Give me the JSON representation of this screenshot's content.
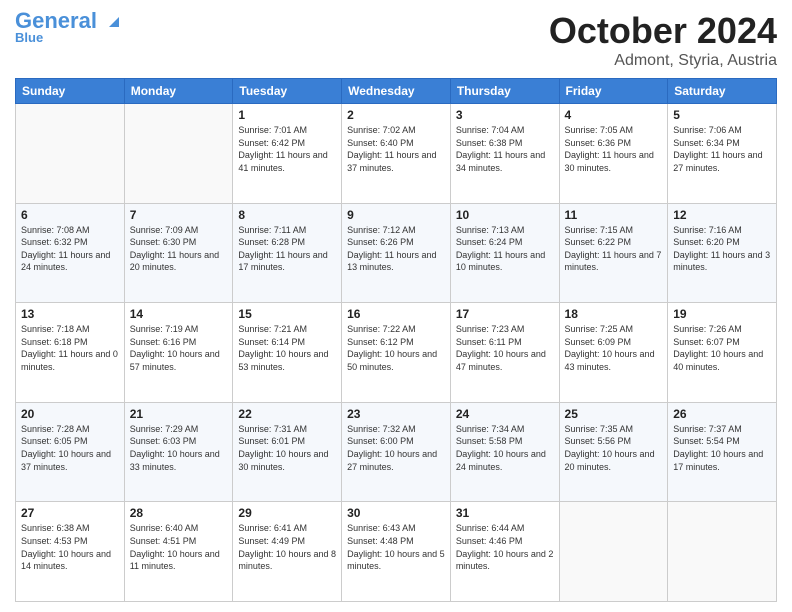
{
  "header": {
    "logo_main": "General",
    "logo_sub": "Blue",
    "month": "October 2024",
    "location": "Admont, Styria, Austria"
  },
  "weekdays": [
    "Sunday",
    "Monday",
    "Tuesday",
    "Wednesday",
    "Thursday",
    "Friday",
    "Saturday"
  ],
  "weeks": [
    [
      {
        "day": "",
        "info": ""
      },
      {
        "day": "",
        "info": ""
      },
      {
        "day": "1",
        "info": "Sunrise: 7:01 AM\nSunset: 6:42 PM\nDaylight: 11 hours and 41 minutes."
      },
      {
        "day": "2",
        "info": "Sunrise: 7:02 AM\nSunset: 6:40 PM\nDaylight: 11 hours and 37 minutes."
      },
      {
        "day": "3",
        "info": "Sunrise: 7:04 AM\nSunset: 6:38 PM\nDaylight: 11 hours and 34 minutes."
      },
      {
        "day": "4",
        "info": "Sunrise: 7:05 AM\nSunset: 6:36 PM\nDaylight: 11 hours and 30 minutes."
      },
      {
        "day": "5",
        "info": "Sunrise: 7:06 AM\nSunset: 6:34 PM\nDaylight: 11 hours and 27 minutes."
      }
    ],
    [
      {
        "day": "6",
        "info": "Sunrise: 7:08 AM\nSunset: 6:32 PM\nDaylight: 11 hours and 24 minutes."
      },
      {
        "day": "7",
        "info": "Sunrise: 7:09 AM\nSunset: 6:30 PM\nDaylight: 11 hours and 20 minutes."
      },
      {
        "day": "8",
        "info": "Sunrise: 7:11 AM\nSunset: 6:28 PM\nDaylight: 11 hours and 17 minutes."
      },
      {
        "day": "9",
        "info": "Sunrise: 7:12 AM\nSunset: 6:26 PM\nDaylight: 11 hours and 13 minutes."
      },
      {
        "day": "10",
        "info": "Sunrise: 7:13 AM\nSunset: 6:24 PM\nDaylight: 11 hours and 10 minutes."
      },
      {
        "day": "11",
        "info": "Sunrise: 7:15 AM\nSunset: 6:22 PM\nDaylight: 11 hours and 7 minutes."
      },
      {
        "day": "12",
        "info": "Sunrise: 7:16 AM\nSunset: 6:20 PM\nDaylight: 11 hours and 3 minutes."
      }
    ],
    [
      {
        "day": "13",
        "info": "Sunrise: 7:18 AM\nSunset: 6:18 PM\nDaylight: 11 hours and 0 minutes."
      },
      {
        "day": "14",
        "info": "Sunrise: 7:19 AM\nSunset: 6:16 PM\nDaylight: 10 hours and 57 minutes."
      },
      {
        "day": "15",
        "info": "Sunrise: 7:21 AM\nSunset: 6:14 PM\nDaylight: 10 hours and 53 minutes."
      },
      {
        "day": "16",
        "info": "Sunrise: 7:22 AM\nSunset: 6:12 PM\nDaylight: 10 hours and 50 minutes."
      },
      {
        "day": "17",
        "info": "Sunrise: 7:23 AM\nSunset: 6:11 PM\nDaylight: 10 hours and 47 minutes."
      },
      {
        "day": "18",
        "info": "Sunrise: 7:25 AM\nSunset: 6:09 PM\nDaylight: 10 hours and 43 minutes."
      },
      {
        "day": "19",
        "info": "Sunrise: 7:26 AM\nSunset: 6:07 PM\nDaylight: 10 hours and 40 minutes."
      }
    ],
    [
      {
        "day": "20",
        "info": "Sunrise: 7:28 AM\nSunset: 6:05 PM\nDaylight: 10 hours and 37 minutes."
      },
      {
        "day": "21",
        "info": "Sunrise: 7:29 AM\nSunset: 6:03 PM\nDaylight: 10 hours and 33 minutes."
      },
      {
        "day": "22",
        "info": "Sunrise: 7:31 AM\nSunset: 6:01 PM\nDaylight: 10 hours and 30 minutes."
      },
      {
        "day": "23",
        "info": "Sunrise: 7:32 AM\nSunset: 6:00 PM\nDaylight: 10 hours and 27 minutes."
      },
      {
        "day": "24",
        "info": "Sunrise: 7:34 AM\nSunset: 5:58 PM\nDaylight: 10 hours and 24 minutes."
      },
      {
        "day": "25",
        "info": "Sunrise: 7:35 AM\nSunset: 5:56 PM\nDaylight: 10 hours and 20 minutes."
      },
      {
        "day": "26",
        "info": "Sunrise: 7:37 AM\nSunset: 5:54 PM\nDaylight: 10 hours and 17 minutes."
      }
    ],
    [
      {
        "day": "27",
        "info": "Sunrise: 6:38 AM\nSunset: 4:53 PM\nDaylight: 10 hours and 14 minutes."
      },
      {
        "day": "28",
        "info": "Sunrise: 6:40 AM\nSunset: 4:51 PM\nDaylight: 10 hours and 11 minutes."
      },
      {
        "day": "29",
        "info": "Sunrise: 6:41 AM\nSunset: 4:49 PM\nDaylight: 10 hours and 8 minutes."
      },
      {
        "day": "30",
        "info": "Sunrise: 6:43 AM\nSunset: 4:48 PM\nDaylight: 10 hours and 5 minutes."
      },
      {
        "day": "31",
        "info": "Sunrise: 6:44 AM\nSunset: 4:46 PM\nDaylight: 10 hours and 2 minutes."
      },
      {
        "day": "",
        "info": ""
      },
      {
        "day": "",
        "info": ""
      }
    ]
  ]
}
